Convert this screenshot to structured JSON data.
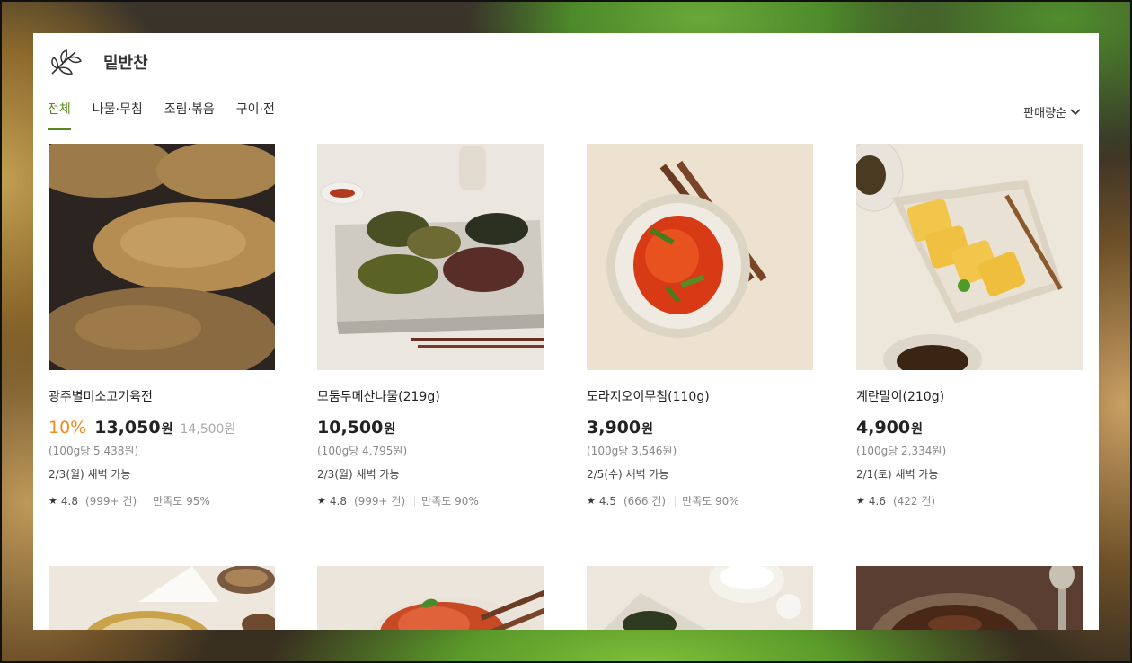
{
  "header": {
    "title": "밑반찬",
    "logo_icon": "leaf-icon"
  },
  "tabs": [
    {
      "label": "전체",
      "active": true
    },
    {
      "label": "나물·무침",
      "active": false
    },
    {
      "label": "조림·볶음",
      "active": false
    },
    {
      "label": "구이·전",
      "active": false
    }
  ],
  "sort": {
    "label": "판매량순",
    "icon": "chevron-down-icon"
  },
  "products": [
    {
      "name": "광주별미소고기육전",
      "discount": "10%",
      "price": "13,050",
      "currency": "원",
      "original_price": "14,500원",
      "unit_price": "(100g당 5,438원)",
      "delivery": "2/3(월) 새벽 가능",
      "rating": "4.8",
      "reviews": "(999+ 건)",
      "satisfaction": "만족도 95%"
    },
    {
      "name": "모둠두메산나물(219g)",
      "discount": "",
      "price": "10,500",
      "currency": "원",
      "original_price": "",
      "unit_price": "(100g당 4,795원)",
      "delivery": "2/3(월) 새벽 가능",
      "rating": "4.8",
      "reviews": "(999+ 건)",
      "satisfaction": "만족도 90%"
    },
    {
      "name": "도라지오이무침(110g)",
      "discount": "",
      "price": "3,900",
      "currency": "원",
      "original_price": "",
      "unit_price": "(100g당 3,546원)",
      "delivery": "2/5(수) 새벽 가능",
      "rating": "4.5",
      "reviews": "(666 건)",
      "satisfaction": "만족도 90%"
    },
    {
      "name": "계란말이(210g)",
      "discount": "",
      "price": "4,900",
      "currency": "원",
      "original_price": "",
      "unit_price": "(100g당 2,334원)",
      "delivery": "2/1(토) 새벽 가능",
      "rating": "4.6",
      "reviews": "(422 건)",
      "satisfaction": ""
    }
  ],
  "colors": {
    "accent": "#5a8a1f",
    "discount": "#f08a1a"
  }
}
